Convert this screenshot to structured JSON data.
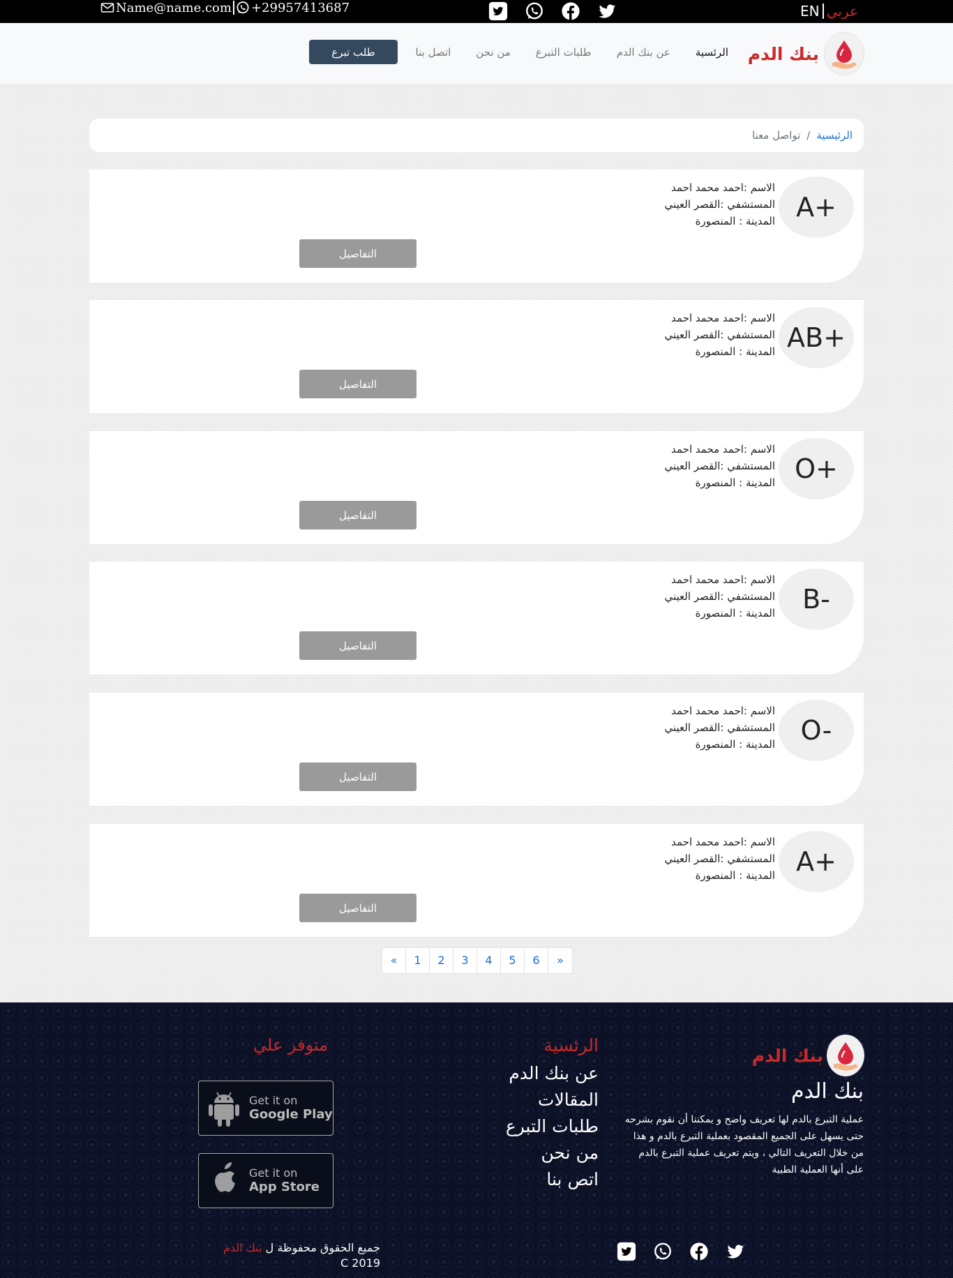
{
  "topbar": {
    "email": "Name@name.com",
    "phone": "+29957413687",
    "lang_en": "EN",
    "lang_ar": "عربي",
    "social_icons": [
      "twitter-square-icon",
      "whatsapp-icon",
      "facebook-icon",
      "twitter-icon"
    ]
  },
  "nav": {
    "brand": "بنك الدم",
    "links": [
      "الرئسية",
      "عن بنك الدم",
      "طلبات التبرع",
      "من نحن",
      "اتصل بنا"
    ],
    "cta": "طلب تبرع"
  },
  "breadcrumb": {
    "home": "الرئيسية",
    "separator": "/",
    "current": "تواصل معنا"
  },
  "cards": [
    {
      "blood_type": "A+",
      "name": "الاسم :احمد محمد احمد",
      "hospital": "المستشفي :القصر العيني",
      "city": "المدينة : المنصورة",
      "button": "التفاصيل"
    },
    {
      "blood_type": "AB+",
      "name": "الاسم :احمد محمد احمد",
      "hospital": "المستشفي :القصر العيني",
      "city": "المدينة : المنصورة",
      "button": "التفاصيل"
    },
    {
      "blood_type": "O+",
      "name": "الاسم :احمد محمد احمد",
      "hospital": "المستشفي :القصر العيني",
      "city": "المدينة : المنصورة",
      "button": "التفاصيل"
    },
    {
      "blood_type": "B-",
      "name": "الاسم :احمد محمد احمد",
      "hospital": "المستشفي :القصر العيني",
      "city": "المدينة : المنصورة",
      "button": "التفاصيل"
    },
    {
      "blood_type": "O-",
      "name": "الاسم :احمد محمد احمد",
      "hospital": "المستشفي :القصر العيني",
      "city": "المدينة : المنصورة",
      "button": "التفاصيل"
    },
    {
      "blood_type": "A+",
      "name": "الاسم :احمد محمد احمد",
      "hospital": "المستشفي :القصر العيني",
      "city": "المدينة : المنصورة",
      "button": "التفاصيل"
    }
  ],
  "pagination": [
    "«",
    "1",
    "2",
    "3",
    "4",
    "5",
    "6",
    "»"
  ],
  "footer": {
    "brand": "بنك الدم",
    "title": "بنك الدم",
    "description": "عملية التبرع بالدم لها تعريف واضح و يمكننا أن نقوم بشرحه حتى يسهل على الجميع المقصود بعملية التبرع بالدم و هذا من خلال التعريف التالي ، ويتم تعريف عملية التبرع بالدم على أنها العملية الطبية",
    "links_heading": "الرئسية",
    "links": [
      "عن بنك الدم",
      "المقالات",
      "طلبات التبرع",
      "من نحن",
      "اتص بنا"
    ],
    "available_heading": "متوفر علي",
    "google_play": {
      "small": "Get it on",
      "big": "Google Play"
    },
    "app_store": {
      "small": "Get it on",
      "big": "App Store"
    },
    "copyright_prefix": "جميع الحقوق محفوظة ل",
    "copyright_brand": "بنك الدم",
    "copyright_year": "C 2019"
  },
  "colors": {
    "brand_red": "#c92a2a",
    "cta_bg": "#34495e",
    "button_grey": "#9a9a9a",
    "link_blue": "#1a6fd6",
    "footer_bg": "#0c1125"
  }
}
